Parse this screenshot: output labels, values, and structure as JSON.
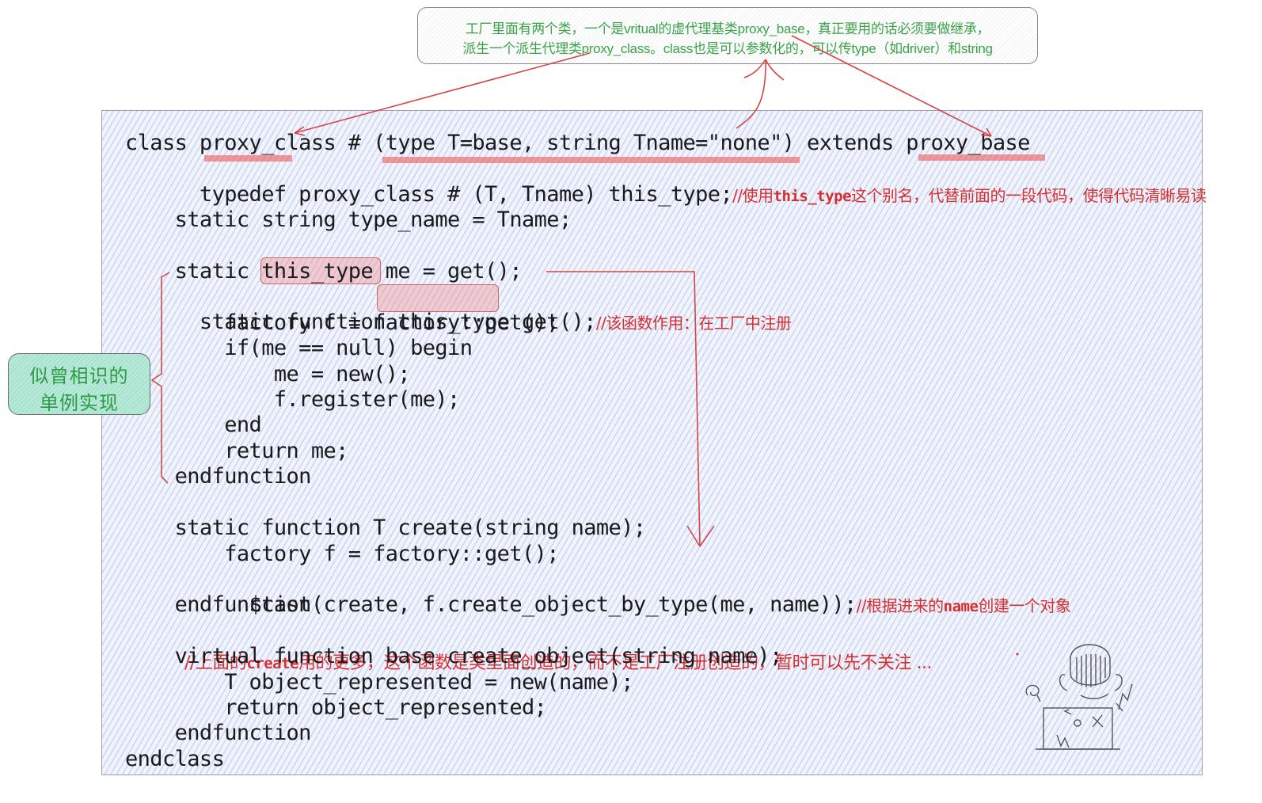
{
  "note": {
    "line1": "工厂里面有两个类，一个是vritual的虚代理基类proxy_base，真正要用的话必须要做继承，",
    "line2": "派生一个派生代理类proxy_class。class也是可以参数化的，可以传type（如driver）和string"
  },
  "badge": {
    "line1": "似曾相识的",
    "line2": "单例实现"
  },
  "code": {
    "lines": [
      "class proxy_class # (type T=base, string Tname=\"none\") extends proxy_base",
      "    typedef proxy_class # (T, Tname) this_type;",
      "",
      "    static string type_name = Tname;",
      "",
      "    static this_type me = get();",
      "    static function this_type get();",
      "        factory f = factory::get();",
      "        if(me == null) begin",
      "            me = new();",
      "            f.register(me);",
      "        end",
      "        return me;",
      "    endfunction",
      "",
      "    static function T create(string name);",
      "        factory f = factory::get();",
      "        $cast(create, f.create_object_by_type(me, name));",
      "    endfunction",
      "    virtual function base create_object(string name);",
      "        T object_represented = new(name);",
      "        return object_represented;",
      "    endfunction",
      "endclass"
    ]
  },
  "comments": {
    "typedef": {
      "pre": "//使用",
      "mono": "this_type",
      "post": "这个别名，代替前面的一段代码，使得代码清晰易读"
    },
    "get": {
      "pre": "//该函数作用：在工厂中注册"
    },
    "cast": {
      "pre": "//根据进来的",
      "mono": "name",
      "post": "创建一个对象"
    },
    "create_object": {
      "pre": "//上面的",
      "mono": "create",
      "post": "用的更多，这个函数是类里面创造的，而不是工厂注册创造的，暂时可以先不关注 ..."
    }
  },
  "colors": {
    "note_text": "#3aa34a",
    "annotation_red": "#d62f2f",
    "highlight_fill": "#f09696",
    "badge_fill": "#b6e9d8"
  }
}
